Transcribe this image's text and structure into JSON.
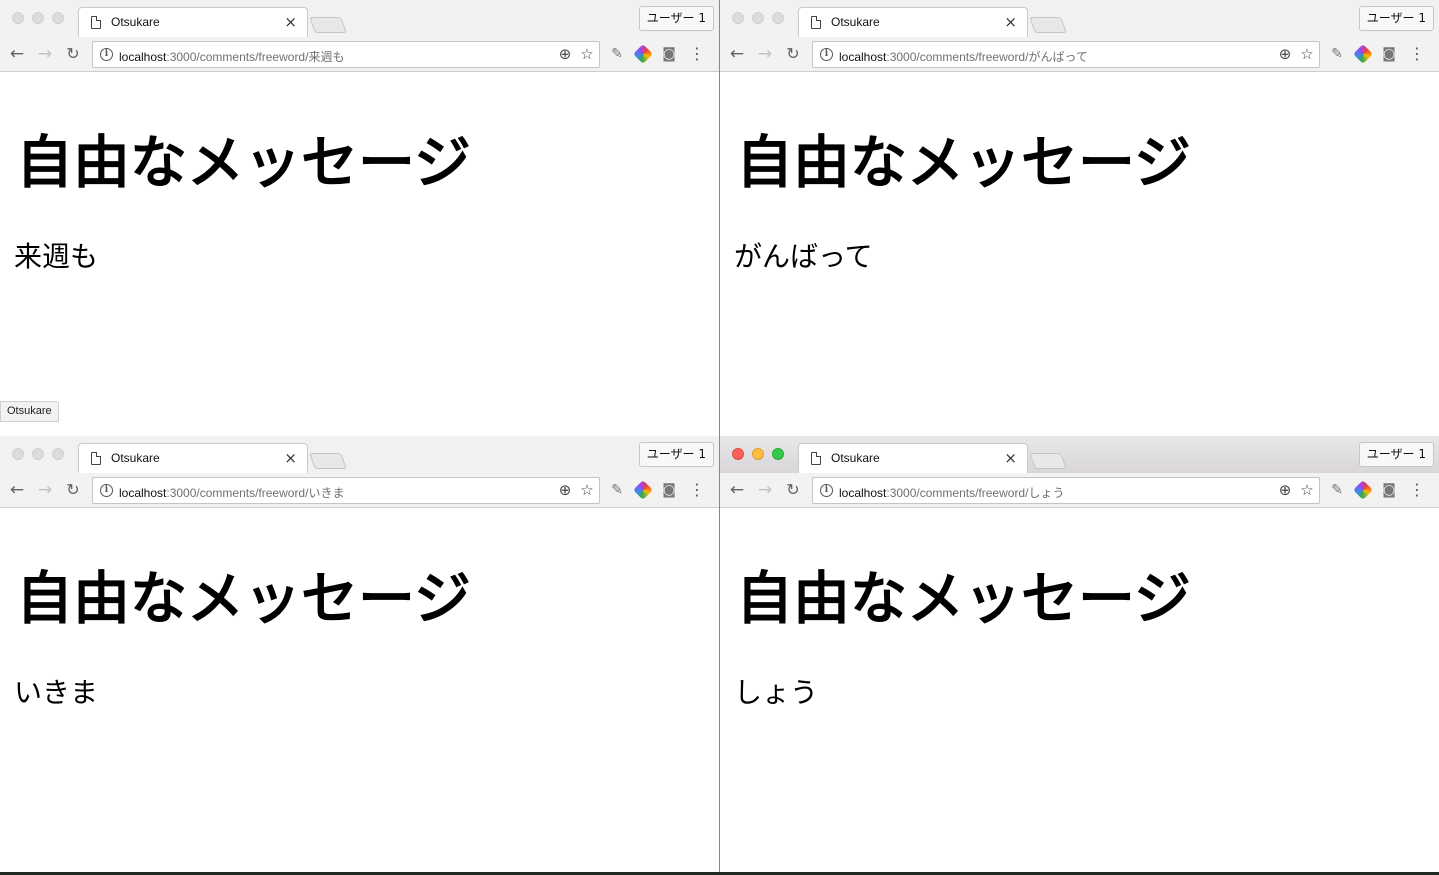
{
  "windows": [
    {
      "tab_title": "Otsukare",
      "profile": "ユーザー 1",
      "url_host": "localhost",
      "url_path": ":3000/comments/freeword/来週も",
      "heading": "自由なメッセージ",
      "message": "来週も",
      "status_tooltip": "Otsukare"
    },
    {
      "tab_title": "Otsukare",
      "profile": "ユーザー 1",
      "url_host": "localhost",
      "url_path": ":3000/comments/freeword/がんばって",
      "heading": "自由なメッセージ",
      "message": "がんばって"
    },
    {
      "tab_title": "Otsukare",
      "profile": "ユーザー 1",
      "url_host": "localhost",
      "url_path": ":3000/comments/freeword/いきま",
      "heading": "自由なメッセージ",
      "message": "いきま"
    },
    {
      "tab_title": "Otsukare",
      "profile": "ユーザー 1",
      "url_host": "localhost",
      "url_path": ":3000/comments/freeword/しょう",
      "heading": "自由なメッセージ",
      "message": "しょう"
    }
  ],
  "icons": {
    "close_tab": "×",
    "back": "←",
    "forward": "→",
    "reload": "↻",
    "info": "i",
    "zoom": "⊕",
    "bookmark": "☆",
    "camera": "◙",
    "menu": "⋮",
    "extension": "✎"
  }
}
